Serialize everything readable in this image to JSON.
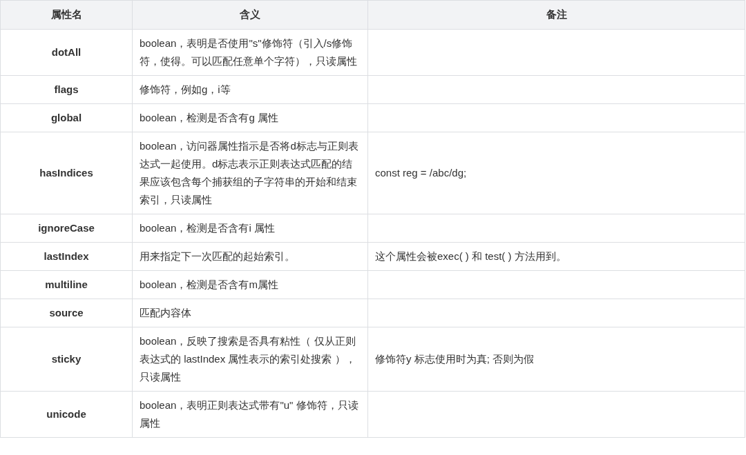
{
  "table": {
    "columns": [
      "属性名",
      "含义",
      "备注"
    ],
    "rows": [
      {
        "name": "dotAll",
        "meaning": "boolean，表明是否使用\"s\"修饰符（引入/s修饰符，使得。可以匹配任意单个字符），只读属性",
        "note": ""
      },
      {
        "name": "flags",
        "meaning": "修饰符，例如g，i等",
        "note": ""
      },
      {
        "name": "global",
        "meaning": "boolean，检测是否含有g 属性",
        "note": ""
      },
      {
        "name": "hasIndices",
        "meaning": "boolean，访问器属性指示是否将d标志与正则表达式一起使用。d标志表示正则表达式匹配的结果应该包含每个捕获组的子字符串的开始和结束索引，只读属性",
        "note": "const reg = /abc/dg;"
      },
      {
        "name": "ignoreCase",
        "meaning": "boolean，检测是否含有i 属性",
        "note": ""
      },
      {
        "name": "lastIndex",
        "meaning": "用来指定下一次匹配的起始索引。",
        "note": "这个属性会被exec( ) 和 test( ) 方法用到。"
      },
      {
        "name": "multiline",
        "meaning": "boolean，检测是否含有m属性",
        "note": ""
      },
      {
        "name": "source",
        "meaning": "匹配内容体",
        "note": ""
      },
      {
        "name": "sticky",
        "meaning": "boolean，反映了搜索是否具有粘性（ 仅从正则表达式的 lastIndex 属性表示的索引处搜索 ），只读属性",
        "note": "修饰符y 标志使用时为真; 否则为假"
      },
      {
        "name": "unicode",
        "meaning": "boolean，表明正则表达式带有\"u\" 修饰符，只读属性",
        "note": ""
      }
    ]
  }
}
